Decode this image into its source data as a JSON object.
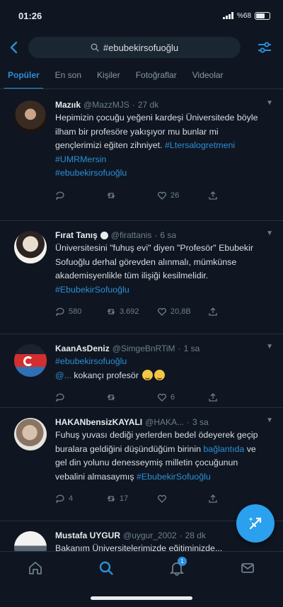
{
  "status": {
    "time": "01:26",
    "battery": "%68",
    "battery_level": 0.68
  },
  "search": {
    "query": "#ebubekirsofuoğlu"
  },
  "tabs": [
    "Popüler",
    "En son",
    "Kişiler",
    "Fotoğraflar",
    "Videolar"
  ],
  "tweets": [
    {
      "author": "Mazıık",
      "handle": "@MazzMJS",
      "time": "27 dk",
      "body": "Hepimizin çocuğu yeğeni kardeşi Üniversitede böyle ilham bir profesöre yakışıyor mu bunlar mi gençlerimizi eğiten zihniyet.",
      "links": [
        "#Ltersalogretmeni",
        "#UMRMersin",
        "#ebubekirsofuoğlu"
      ],
      "link_inline": "#Ltersalogretmeni",
      "reply": "",
      "retweet": "",
      "like": "26",
      "share": ""
    },
    {
      "author": "Fırat Tanış",
      "handle": "@firattanis",
      "time": "6 sa",
      "body": "Üniversitesini \"fuhuş evi\" diyen \"Profesör\" Ebubekir Sofuoğlu derhal görevden alınmalı, mümkünse akademisyenlikle tüm ilişiği kesilmelidir.",
      "links": [
        "#EbubekirSofuoğlu"
      ],
      "reply": "580",
      "retweet": "3.692",
      "like": "20,8B",
      "share": ""
    },
    {
      "author": "KaanAsDeniz",
      "handle": "@SimgeBnRTiM",
      "time": "1 sa",
      "body": "",
      "links": [
        "#ebubekirsofuoğlu"
      ],
      "mention": "@...",
      "tail": " kokançı profesör",
      "reply": "",
      "retweet": "",
      "like": "6",
      "share": ""
    },
    {
      "author": "HAKANbensizKAYALI",
      "handle": "@HAKA...",
      "time": "3 sa",
      "body_pre": "Fuhuş yuvası dediği yerlerden bedel ödeyerek geçip buralara geldiğini düşündüğüm birinin ",
      "body_mention": "bağlantıda",
      "body_mid": " ve gel din yolunu denesseymiş milletin çocuğunun vebalini almasaymış ",
      "body_tag": "#EbubekirSofuoğlu",
      "reply": "4",
      "retweet": "17",
      "like": "",
      "share": ""
    },
    {
      "author": "Mustafa UYGUR",
      "handle": "@uygur_2002",
      "time": "28 dk",
      "body": "Bakanım Üniversitelerimizde eğitiminizde..."
    }
  ],
  "icons": {
    "back": "chevron-left-icon",
    "search": "search-icon",
    "settings": "sliders-icon",
    "compose": "compose-feather-icon",
    "nav": [
      "home-icon",
      "search-icon",
      "notifications-icon",
      "messages-icon"
    ]
  },
  "nav": {
    "notifications_badge": "1"
  },
  "colors": {
    "background": "#0f1621",
    "accent": "#2c8ed6",
    "fab": "#2aa0ee",
    "muted": "#6e7d8c"
  }
}
